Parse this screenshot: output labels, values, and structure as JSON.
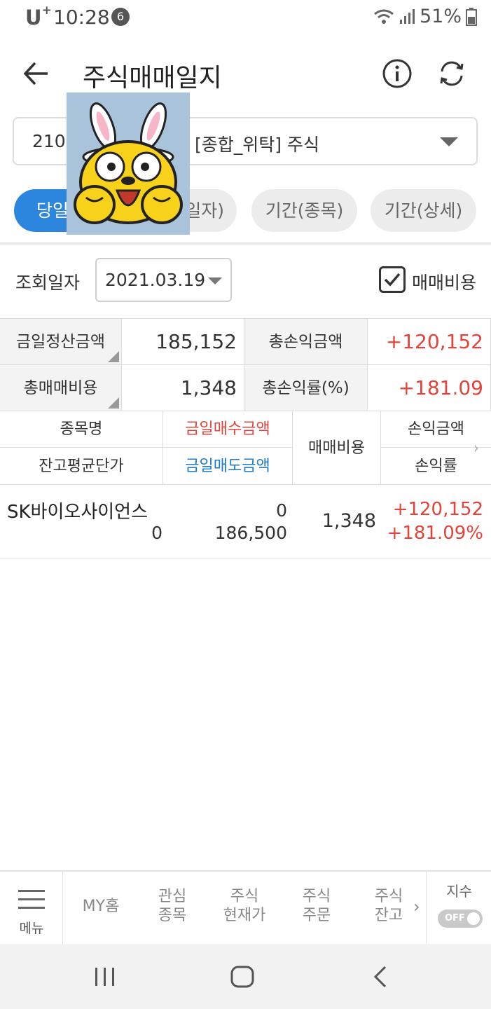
{
  "status_bar": {
    "carrier": "U",
    "carrier_sup": "+",
    "time": "10:28",
    "notification_count": "6",
    "battery": "51%"
  },
  "header": {
    "title": "주식매매일지",
    "back_icon": "arrow-left-icon",
    "info_icon": "info-circle-icon",
    "refresh_icon": "refresh-icon"
  },
  "account": {
    "number": "210-",
    "type": "[종합_위탁] 주식"
  },
  "tabs": [
    {
      "label": "당일",
      "active": true
    },
    {
      "label": "일자)",
      "active": false
    },
    {
      "label": "기간(종목)",
      "active": false
    },
    {
      "label": "기간(상세)",
      "active": false
    }
  ],
  "query": {
    "date_label": "조회일자",
    "date_value": "2021.03.19",
    "fee_label": "매매비용",
    "fee_checked": true
  },
  "summary": {
    "settle_label": "금일정산금액",
    "settle_value": "185,152",
    "total_pl_label": "총손익금액",
    "total_pl_value": "+120,152",
    "total_fee_label": "총매매비용",
    "total_fee_value": "1,348",
    "total_rate_label": "총손익률(%)",
    "total_rate_value": "+181.09"
  },
  "list_header": {
    "name": "종목명",
    "avg_price": "잔고평균단가",
    "buy_amount": "금일매수금액",
    "sell_amount": "금일매도금액",
    "fee": "매매비용",
    "pl_amount": "손익금액",
    "pl_rate": "손익률"
  },
  "rows": [
    {
      "name": "SK바이오사이언스",
      "avg_price": "0",
      "buy_amount": "0",
      "sell_amount": "186,500",
      "fee": "1,348",
      "pl_amount": "+120,152",
      "pl_rate": "+181.09%"
    }
  ],
  "bottom_nav": {
    "menu": "메뉴",
    "items": [
      {
        "line1": "MY홈",
        "line2": ""
      },
      {
        "line1": "관심",
        "line2": "종목"
      },
      {
        "line1": "주식",
        "line2": "현재가"
      },
      {
        "line1": "주식",
        "line2": "주문"
      },
      {
        "line1": "주식",
        "line2": "잔고"
      }
    ],
    "index_label": "지수",
    "toggle_text": "OFF"
  },
  "colors": {
    "accent": "#2c86de",
    "profit_red": "#e2433a",
    "sell_blue": "#1e7bc8"
  }
}
